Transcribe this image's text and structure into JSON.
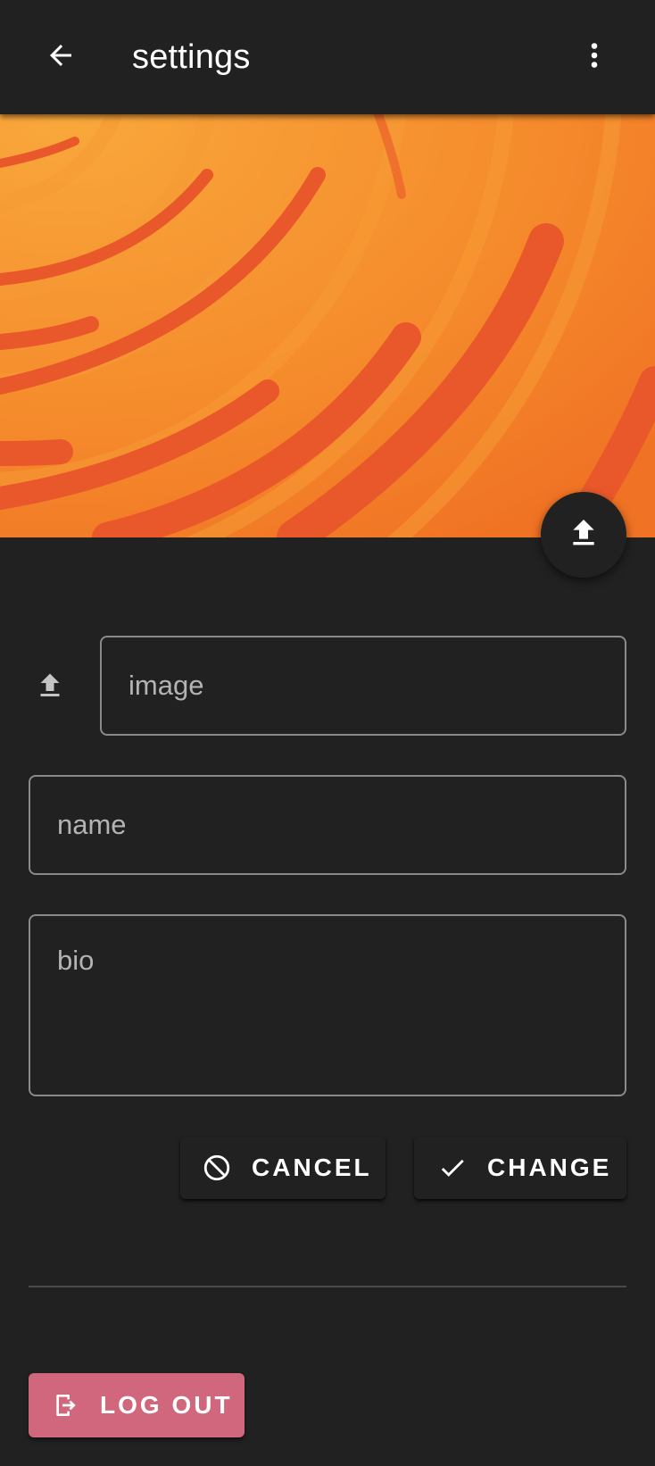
{
  "app_bar": {
    "title": "settings",
    "back_icon": "arrow-left-icon",
    "menu_icon": "dots-vertical-icon"
  },
  "banner": {
    "description_colors": [
      "#f7a13a",
      "#f07a26",
      "#e8552a"
    ],
    "upload_icon": "upload-icon"
  },
  "form": {
    "image_placeholder": "image",
    "name_placeholder": "name",
    "bio_placeholder": "bio",
    "image_field_icon": "upload-icon"
  },
  "actions": {
    "cancel_label": "CANCEL",
    "cancel_icon": "cancel-circle-icon",
    "change_label": "CHANGE",
    "change_icon": "check-icon"
  },
  "logout": {
    "label": "LOG OUT",
    "icon": "logout-icon",
    "color": "#d0677c"
  }
}
